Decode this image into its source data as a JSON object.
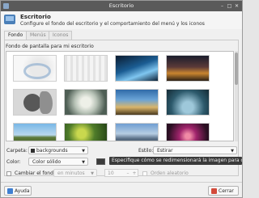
{
  "window": {
    "title": "Escritorio"
  },
  "header": {
    "title": "Escritorio",
    "subtitle": "Configure el fondo del escritorio y el comportamiento del menú y los iconos"
  },
  "tabs": [
    {
      "label": "Fondo",
      "active": true
    },
    {
      "label": "Menús",
      "active": false
    },
    {
      "label": "Iconos",
      "active": false
    }
  ],
  "section": {
    "label": "Fondo de pantalla para mi escritorio"
  },
  "gallery": {
    "thumbnails": [
      "wallpaper-light-swirl",
      "wallpaper-light-stripes",
      "wallpaper-blue-lines",
      "wallpaper-sunset",
      "wallpaper-gray-circles",
      "wallpaper-cloud-burst",
      "wallpaper-desert-sky",
      "wallpaper-dark-water",
      "wallpaper-lake-landscape",
      "wallpaper-green-leaves",
      "wallpaper-blue-mountains",
      "wallpaper-pink-lights"
    ]
  },
  "controls": {
    "folder_label": "Carpeta:",
    "folder_value": "backgrounds",
    "style_label": "Estilo:",
    "style_value": "Estirar",
    "color_label": "Color:",
    "color_value": "Color sólido",
    "color_hex": "#3b3b3b",
    "tooltip": "Especifique cómo se redimensionará la imagen para que se ajuste",
    "change_label": "Cambiar el fondo",
    "interval_value": "en minutos",
    "number_value": "10",
    "random_label": "Orden aleatorio"
  },
  "footer": {
    "help_label": "Ayuda",
    "close_label": "Cerrar"
  }
}
